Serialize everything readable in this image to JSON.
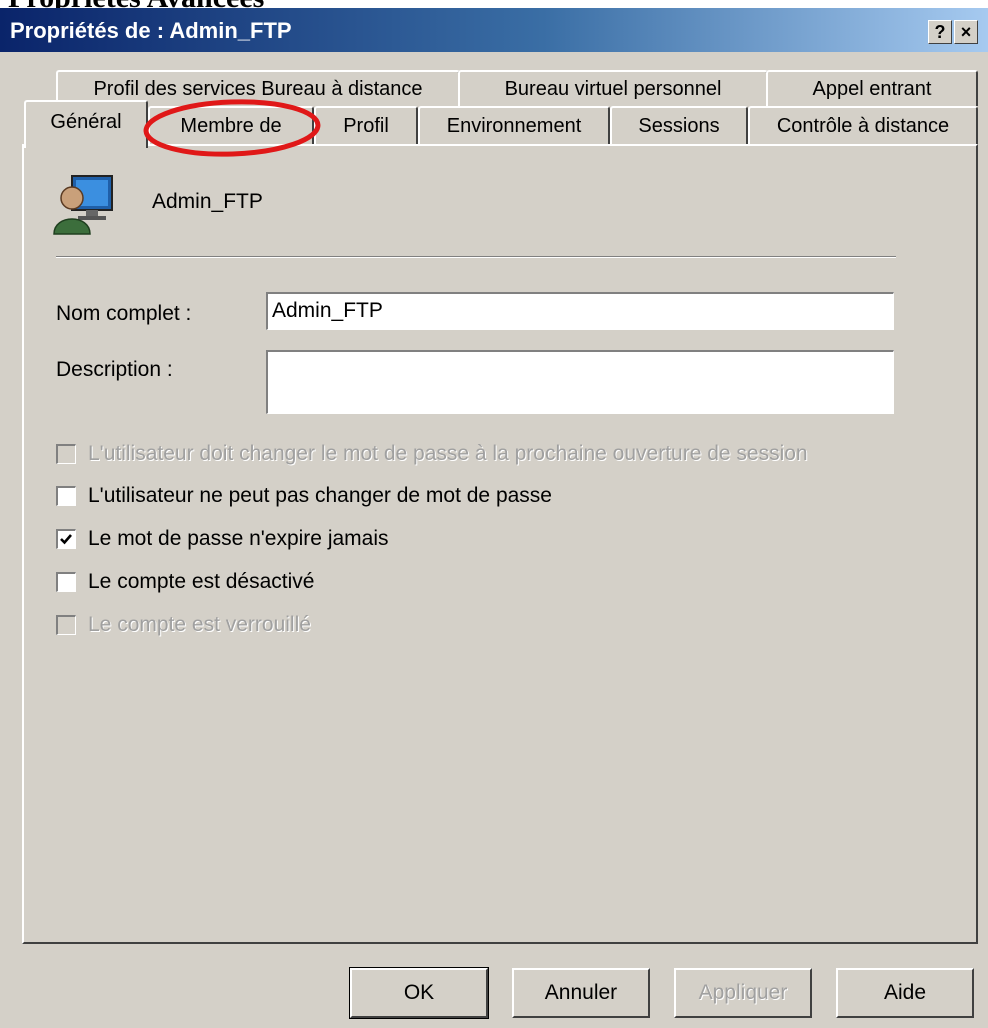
{
  "window": {
    "title": "Propriétés de : Admin_FTP",
    "help_glyph": "?",
    "close_glyph": "×",
    "header_text": "Propriétés Avancées"
  },
  "tabs": {
    "row1": [
      {
        "label": "Profil des services Bureau à distance"
      },
      {
        "label": "Bureau virtuel personnel"
      },
      {
        "label": "Appel entrant"
      }
    ],
    "row2": [
      {
        "label": "Général",
        "active": true
      },
      {
        "label": "Membre de",
        "highlighted": true
      },
      {
        "label": "Profil"
      },
      {
        "label": "Environnement"
      },
      {
        "label": "Sessions"
      },
      {
        "label": "Contrôle à distance"
      }
    ]
  },
  "general": {
    "user_name": "Admin_FTP",
    "user_icon": "user-account-icon",
    "full_name_label": "Nom complet :",
    "full_name_value": "Admin_FTP",
    "description_label": "Description :",
    "description_value": ""
  },
  "checkboxes": [
    {
      "label": "L'utilisateur doit changer le mot de passe à la prochaine ouverture de session",
      "checked": false,
      "enabled": false
    },
    {
      "label": "L'utilisateur ne peut pas changer de mot de passe",
      "checked": false,
      "enabled": true
    },
    {
      "label": "Le mot de passe n'expire jamais",
      "checked": true,
      "enabled": true
    },
    {
      "label": "Le compte est désactivé",
      "checked": false,
      "enabled": true
    },
    {
      "label": "Le compte est verrouillé",
      "checked": false,
      "enabled": false
    }
  ],
  "buttons": {
    "ok": "OK",
    "cancel": "Annuler",
    "apply": "Appliquer",
    "help": "Aide"
  },
  "colors": {
    "dialog_bg": "#d4d0c8",
    "titlebar_start": "#0a246a",
    "titlebar_end": "#a6caf0",
    "annotation": "#e01818"
  }
}
